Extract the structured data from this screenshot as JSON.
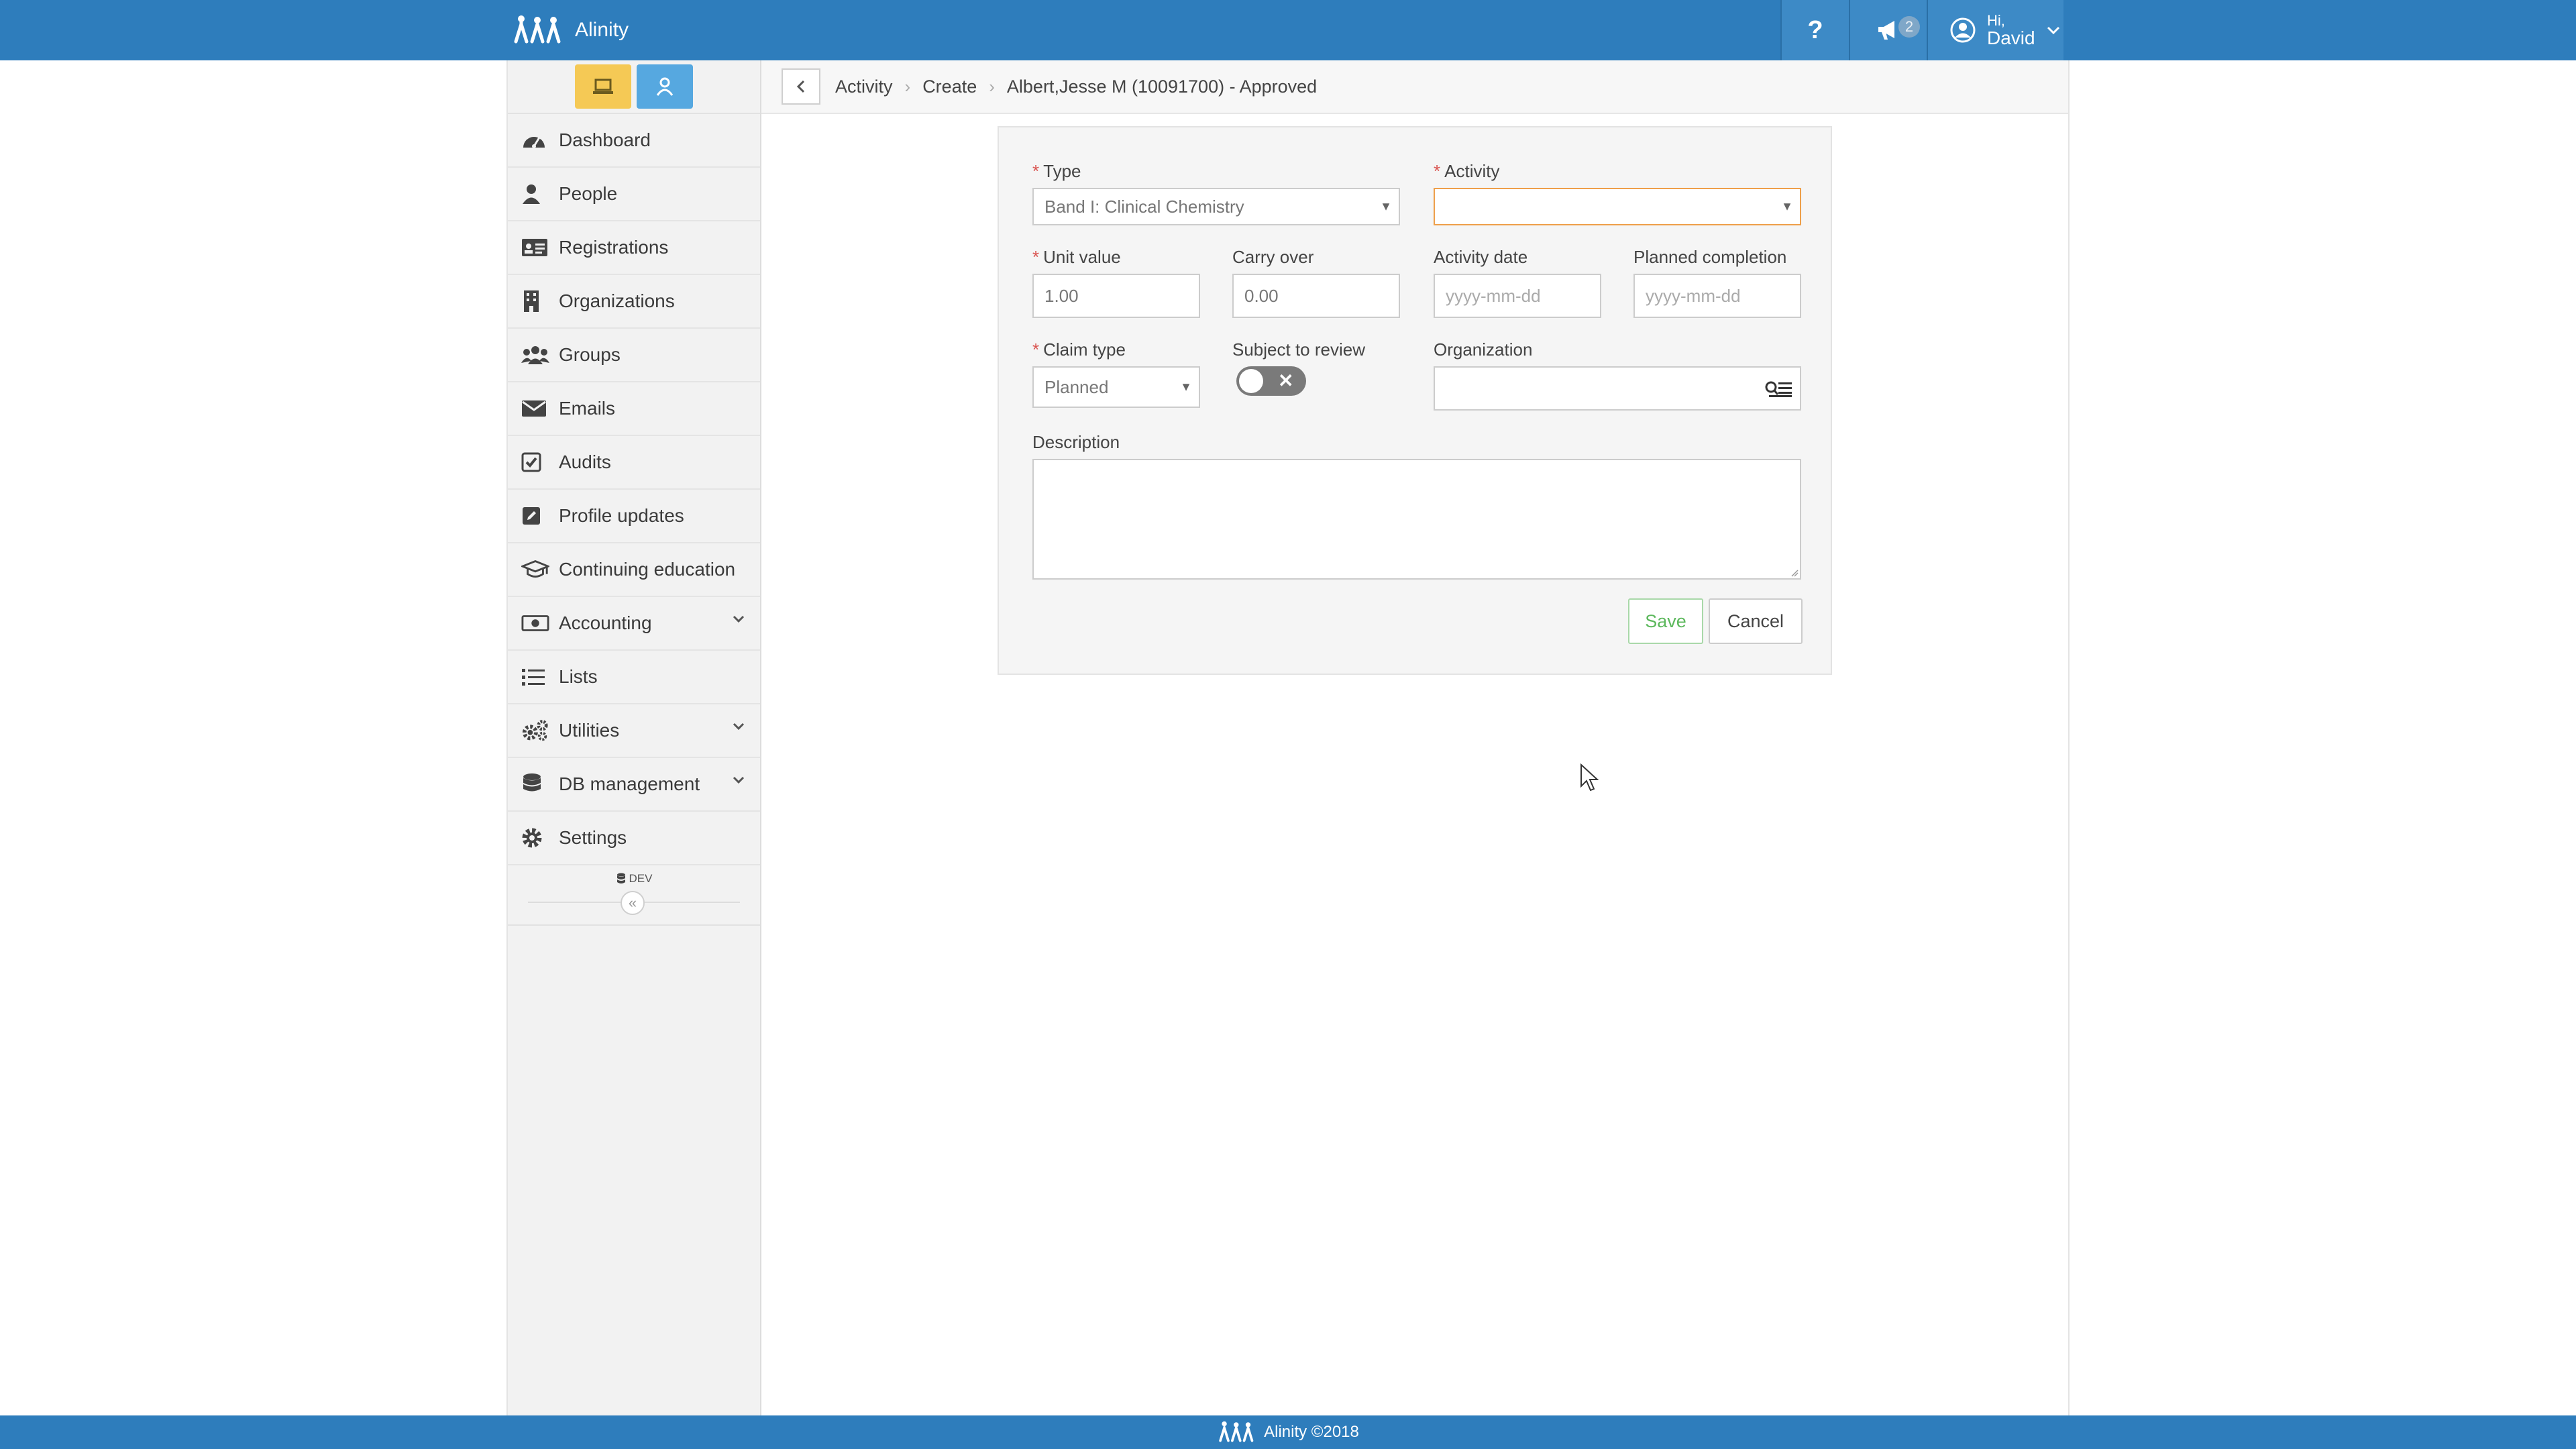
{
  "header": {
    "brand": "Alinity",
    "help_label": "?",
    "notification_count": "2",
    "user_greeting": "Hi,",
    "user_name": "David"
  },
  "sidebar": {
    "items": [
      {
        "label": "Dashboard",
        "icon": "dashboard-icon"
      },
      {
        "label": "People",
        "icon": "person-icon"
      },
      {
        "label": "Registrations",
        "icon": "id-card-icon"
      },
      {
        "label": "Organizations",
        "icon": "building-icon"
      },
      {
        "label": "Groups",
        "icon": "users-icon"
      },
      {
        "label": "Emails",
        "icon": "envelope-icon"
      },
      {
        "label": "Audits",
        "icon": "check-square-icon"
      },
      {
        "label": "Profile updates",
        "icon": "edit-icon"
      },
      {
        "label": "Continuing education",
        "icon": "graduation-cap-icon"
      },
      {
        "label": "Accounting",
        "icon": "money-icon"
      },
      {
        "label": "Lists",
        "icon": "list-icon"
      },
      {
        "label": "Utilities",
        "icon": "cogs-icon"
      },
      {
        "label": "DB management",
        "icon": "database-icon"
      },
      {
        "label": "Settings",
        "icon": "gear-icon"
      }
    ],
    "env_label": "DEV",
    "collapse_label": "«"
  },
  "breadcrumb": {
    "items": [
      "Activity",
      "Create",
      "Albert,Jesse M (10091700) - Approved"
    ],
    "separator": "›"
  },
  "form": {
    "required_mark": "*",
    "type_label": "Type",
    "type_value": "Band I: Clinical Chemistry",
    "activity_label": "Activity",
    "activity_value": "",
    "unit_value_label": "Unit value",
    "unit_value": "1.00",
    "carry_over_label": "Carry over",
    "carry_over_value": "0.00",
    "activity_date_label": "Activity date",
    "activity_date_placeholder": "yyyy-mm-dd",
    "planned_completion_label": "Planned completion",
    "planned_completion_placeholder": "yyyy-mm-dd",
    "claim_type_label": "Claim type",
    "claim_type_value": "Planned",
    "subject_to_review_label": "Subject to review",
    "subject_to_review_on": false,
    "organization_label": "Organization",
    "organization_value": "",
    "description_label": "Description",
    "save_label": "Save",
    "cancel_label": "Cancel"
  },
  "footer": {
    "text": "Alinity ©2018"
  },
  "colors": {
    "brand_blue": "#2e7dbc",
    "mode_yellow": "#f5c955",
    "mode_blue": "#56a8e0",
    "required_red": "#d9534f",
    "focus_orange": "#ee9f4a",
    "save_green": "#5cb85c"
  }
}
